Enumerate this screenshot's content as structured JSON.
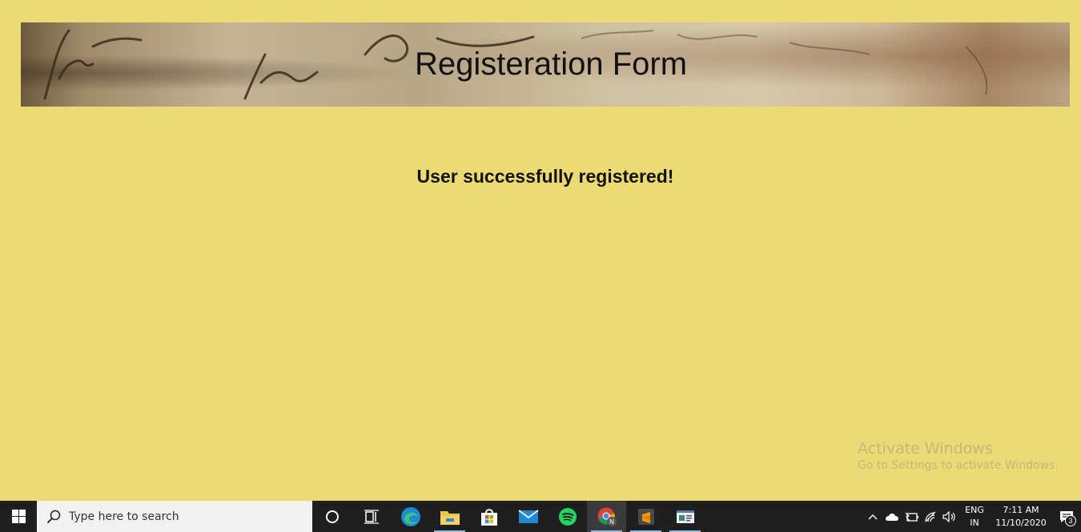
{
  "page": {
    "title": "Registeration Form",
    "message": "User successfully registered!"
  },
  "watermark": {
    "line1": "Activate Windows",
    "line2": "Go to Settings to activate Windows."
  },
  "taskbar": {
    "search_placeholder": "Type here to search",
    "apps": [
      "cortana",
      "task-view",
      "edge",
      "file-explorer",
      "microsoft-store",
      "mail",
      "spotify",
      "chrome",
      "sublime-text",
      "app-window"
    ],
    "language_top": "ENG",
    "language_bottom": "IN",
    "time": "7:11 AM",
    "date": "11/10/2020",
    "notification_count": "3"
  },
  "colors": {
    "background": "#ecda72",
    "taskbar": "#1f1f1f"
  }
}
